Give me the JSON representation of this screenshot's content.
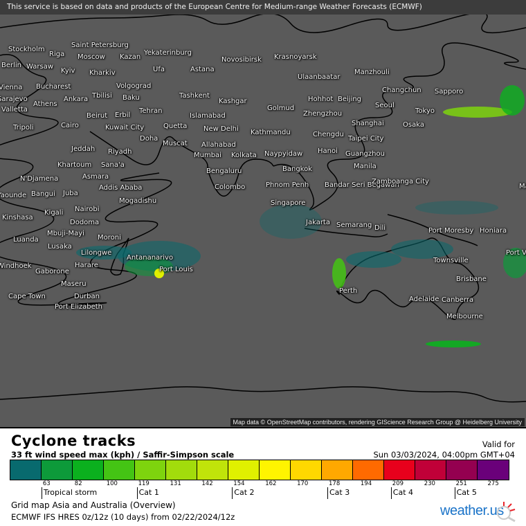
{
  "map": {
    "disclaimer": "This service is based on data and products of the European Centre for Medium-range Weather Forecasts (ECMWF)",
    "attribution": "Map data © OpenStreetMap contributors, rendering GIScience Research Group @ Heidelberg University",
    "background_color": "#5a5a5a",
    "cities": [
      {
        "name": "Stockholm"
      },
      {
        "name": "Saint Petersburg"
      },
      {
        "name": "Riga"
      },
      {
        "name": "Moscow"
      },
      {
        "name": "Kazan"
      },
      {
        "name": "Yekaterinburg"
      },
      {
        "name": "Novosibirsk"
      },
      {
        "name": "Krasnoyarsk"
      },
      {
        "name": "Berlin"
      },
      {
        "name": "Warsaw"
      },
      {
        "name": "Kyiv"
      },
      {
        "name": "Kharkiv"
      },
      {
        "name": "Ufa"
      },
      {
        "name": "Astana"
      },
      {
        "name": "Ulaanbaatar"
      },
      {
        "name": "Manzhouli"
      },
      {
        "name": "Vienna"
      },
      {
        "name": "Bucharest"
      },
      {
        "name": "Volgograd"
      },
      {
        "name": "Changchun"
      },
      {
        "name": "Sapporo"
      },
      {
        "name": "Sarajevo"
      },
      {
        "name": "Athens"
      },
      {
        "name": "Ankara"
      },
      {
        "name": "Tbilisi"
      },
      {
        "name": "Baku"
      },
      {
        "name": "Tashkent"
      },
      {
        "name": "Kashgar"
      },
      {
        "name": "Hohhot"
      },
      {
        "name": "Beijing"
      },
      {
        "name": "Seoul"
      },
      {
        "name": "Tokyo"
      },
      {
        "name": "Valletta"
      },
      {
        "name": "Beirut"
      },
      {
        "name": "Erbil"
      },
      {
        "name": "Tehran"
      },
      {
        "name": "Islamabad"
      },
      {
        "name": "Golmud"
      },
      {
        "name": "Zhengzhou"
      },
      {
        "name": "Osaka"
      },
      {
        "name": "Tripoli"
      },
      {
        "name": "Cairo"
      },
      {
        "name": "Kuwait City"
      },
      {
        "name": "Quetta"
      },
      {
        "name": "New Delhi"
      },
      {
        "name": "Kathmandu"
      },
      {
        "name": "Shanghai"
      },
      {
        "name": "Chengdu"
      },
      {
        "name": "Doha"
      },
      {
        "name": "Muscat"
      },
      {
        "name": "Allahabad"
      },
      {
        "name": "Taipei City"
      },
      {
        "name": "Jeddah"
      },
      {
        "name": "Riyadh"
      },
      {
        "name": "Mumbai"
      },
      {
        "name": "Kolkata"
      },
      {
        "name": "Naypyidaw"
      },
      {
        "name": "Hanoi"
      },
      {
        "name": "Guangzhou"
      },
      {
        "name": "Khartoum"
      },
      {
        "name": "Sana'a"
      },
      {
        "name": "Bengaluru"
      },
      {
        "name": "Bangkok"
      },
      {
        "name": "Manila"
      },
      {
        "name": "Asmara"
      },
      {
        "name": "N'Djamena"
      },
      {
        "name": "Addis Ababa"
      },
      {
        "name": "Colombo"
      },
      {
        "name": "Phnom Penh"
      },
      {
        "name": "Bandar Seri Begawan"
      },
      {
        "name": "Zamboanga City"
      },
      {
        "name": "Yaounde"
      },
      {
        "name": "Bangui"
      },
      {
        "name": "Juba"
      },
      {
        "name": "Mogadishu"
      },
      {
        "name": "Singapore"
      },
      {
        "name": "Kigali"
      },
      {
        "name": "Nairobi"
      },
      {
        "name": "Kinshasa"
      },
      {
        "name": "Dodoma"
      },
      {
        "name": "Jakarta"
      },
      {
        "name": "Semarang"
      },
      {
        "name": "Dili"
      },
      {
        "name": "Port Moresby"
      },
      {
        "name": "Honiara"
      },
      {
        "name": "Mbuji-Mayi"
      },
      {
        "name": "Luanda"
      },
      {
        "name": "Moroni"
      },
      {
        "name": "Lusaka"
      },
      {
        "name": "Lilongwe"
      },
      {
        "name": "Antananarivo"
      },
      {
        "name": "Harare"
      },
      {
        "name": "Port Louis"
      },
      {
        "name": "Windhoek"
      },
      {
        "name": "Gaborone"
      },
      {
        "name": "Townsville"
      },
      {
        "name": "Port Vila"
      },
      {
        "name": "Maseru"
      },
      {
        "name": "Durban"
      },
      {
        "name": "Cape Town"
      },
      {
        "name": "Port Elizabeth"
      },
      {
        "name": "Perth"
      },
      {
        "name": "Brisbane"
      },
      {
        "name": "Adelaide"
      },
      {
        "name": "Canberra"
      },
      {
        "name": "Melbourne"
      },
      {
        "name": "Majuro"
      }
    ]
  },
  "legend": {
    "title": "Cyclone tracks",
    "subtitle": "33 ft wind speed max (kph) / Saffir-Simpson scale",
    "valid_label": "Valid for",
    "valid_date": "Sun 03/03/2024, 04:00pm GMT+04",
    "scale": [
      {
        "color": "#086a6e",
        "label": ""
      },
      {
        "color": "#0d9a3a",
        "label": "63"
      },
      {
        "color": "#0bb01e",
        "label": "82"
      },
      {
        "color": "#44c414",
        "label": "100"
      },
      {
        "color": "#7ed40e",
        "label": "119"
      },
      {
        "color": "#a2dc0c",
        "label": "131"
      },
      {
        "color": "#c0e40a",
        "label": "142"
      },
      {
        "color": "#e0f000",
        "label": "154"
      },
      {
        "color": "#fff400",
        "label": "162"
      },
      {
        "color": "#ffd800",
        "label": "170"
      },
      {
        "color": "#ffa800",
        "label": "178"
      },
      {
        "color": "#ff6a00",
        "label": "194"
      },
      {
        "color": "#e8001c",
        "label": "209"
      },
      {
        "color": "#c00038",
        "label": "230"
      },
      {
        "color": "#940050",
        "label": "251"
      },
      {
        "color": "#6a007a",
        "label": "275"
      }
    ],
    "categories": [
      {
        "label": "Tropical storm",
        "start_index": 1
      },
      {
        "label": "Cat 1",
        "start_index": 4
      },
      {
        "label": "Cat 2",
        "start_index": 7
      },
      {
        "label": "Cat 3",
        "start_index": 10
      },
      {
        "label": "Cat 4",
        "start_index": 12
      },
      {
        "label": "Cat 5",
        "start_index": 14
      }
    ],
    "grid_info": "Grid map Asia and Australia (Overview)",
    "model_info": "ECMWF IFS HRES 0z/12z (10 days) from  02/22/2024/12z",
    "logo_text": "weather.us"
  }
}
